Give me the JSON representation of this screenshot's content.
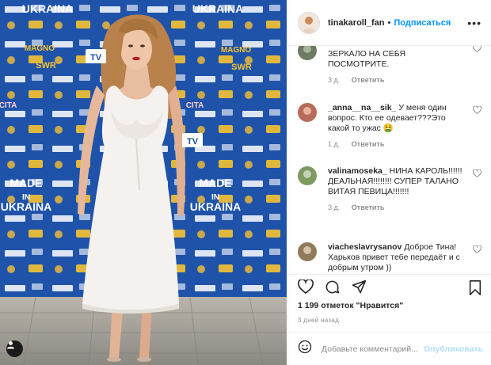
{
  "header": {
    "username": "tinakaroll_fan",
    "separator": "•",
    "follow_label": "Подписаться",
    "more_label": "•••"
  },
  "comments": [
    {
      "user": "",
      "text": "ЗЕРКАЛО НА СЕБЯ ПОСМОТРИТЕ.",
      "time": "3 д.",
      "reply": "Ответить",
      "avatar_color": "#6c7b63"
    },
    {
      "user": "_anna__na__sik_",
      "text": "У меня один вопрос. Кто ее одевает???Это какой то ужас 🤮",
      "time": "1 д.",
      "reply": "Ответить",
      "avatar_color": "#b86b5a"
    },
    {
      "user": "valinamoseka_",
      "text": "НИНА КАРОЛЬ!!!!!!ДЕАЛЬНАЯ!!!!!!!! СУПЕР ТАЛАНО ВИТАЯ ПЕВИЦА!!!!!!!",
      "time": "3 д.",
      "reply": "Ответить",
      "avatar_color": "#7c9a62"
    },
    {
      "user": "viacheslavrysanov",
      "text": "Доброе Тина! Харьков привет тебе передаёт и с добрым утром ))",
      "time": "",
      "reply": "",
      "avatar_color": "#8f7a5c"
    }
  ],
  "post": {
    "likes": "1 199 отметок \"Нравится\"",
    "date": "3 дней назад"
  },
  "add_comment": {
    "placeholder": "Добавьте комментарий...",
    "publish_label": "Опубликовать"
  },
  "backdrop": {
    "ukraina_label": "UKRAINA",
    "made_in_label": "MADE",
    "in_label": "IN",
    "tv_label": "TV",
    "swr_label": "SWR",
    "magnolia_label": "MAGNO",
    "city_label": "CITA"
  },
  "colors": {
    "backdrop_blue": "#1d4fa3",
    "accent_blue": "#0095f6",
    "publish_disabled": "#b2dffc",
    "dress": "#f4f1ee"
  }
}
